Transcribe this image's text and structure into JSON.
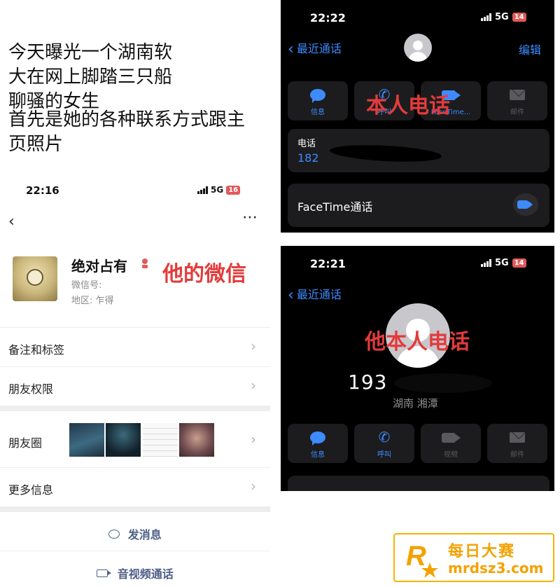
{
  "intro": {
    "lines": [
      "今天曝光一个湖南软",
      "大在网上脚踏三只船",
      "聊骚的女生",
      "首先是她的各种联系方式跟主",
      "页照片"
    ]
  },
  "wechat": {
    "status": {
      "time": "22:16",
      "network": "5G",
      "battery": "16"
    },
    "profile": {
      "nickname": "绝对占有",
      "wechat_id_label": "微信号:",
      "region_label": "地区:",
      "region_value": "乍得",
      "annotation": "他的微信"
    },
    "rows": {
      "remark": "备注和标签",
      "permissions": "朋友权限",
      "moments": "朋友圈",
      "more_info": "更多信息"
    },
    "actions": {
      "message": "发消息",
      "av_call": "音视频通话"
    }
  },
  "phone1": {
    "status": {
      "time": "22:22",
      "network": "5G",
      "battery": "14"
    },
    "back_label": "最近通话",
    "edit_label": "编辑",
    "buttons": {
      "message": "信息",
      "call": "呼叫",
      "facetime": "FaceTime...",
      "mail": "邮件"
    },
    "annotation": "本人电话",
    "phone_label": "电话",
    "phone_value": "182",
    "facetime_row": "FaceTime通话"
  },
  "phone2": {
    "status": {
      "time": "22:21",
      "network": "5G",
      "battery": "14"
    },
    "back_label": "最近通话",
    "annotation": "他本人电话",
    "number": "193",
    "location": "湖南 湘潭",
    "buttons": {
      "message": "信息",
      "call": "呼叫",
      "video": "视频",
      "mail": "邮件"
    }
  },
  "watermark": {
    "title": "每日大赛",
    "url": "mrdsz3.com",
    "logo_letter": "R"
  },
  "colors": {
    "annotation_red": "#e33b3b",
    "ios_blue": "#3e8bff",
    "wechat_link": "#4e5f86",
    "watermark_gold": "#f3a200"
  },
  "icons": [
    "back-chevron-icon",
    "more-dots-icon",
    "signal-icon",
    "battery-icon",
    "person-icon",
    "message-icon",
    "phone-icon",
    "video-camera-icon",
    "mail-icon",
    "chevron-right-icon",
    "chat-bubble-icon"
  ]
}
